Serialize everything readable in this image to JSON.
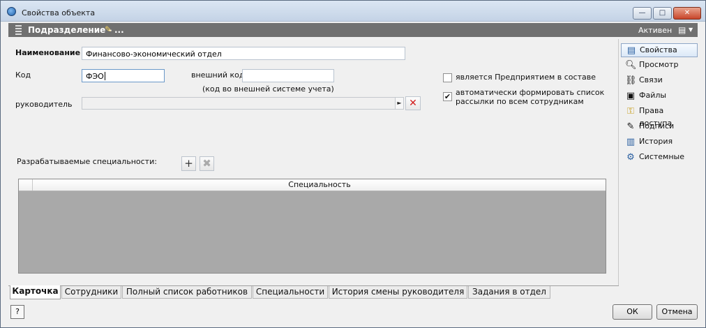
{
  "window": {
    "title": "Свойства объекта",
    "controls": {
      "minimize": "—",
      "maximize": "□",
      "close": "✕"
    }
  },
  "object_bar": {
    "title": "Подразделение -",
    "edit_suffix": "...",
    "status": "Активен",
    "menu_icon": "▤",
    "menu_arrow": "▼"
  },
  "form": {
    "name_label": "Наименование",
    "name_value": "Финансово-экономический отдел",
    "code_label": "Код",
    "code_value": "ФЭО",
    "ext_code_label": "внешний код",
    "ext_code_value": "",
    "ext_code_hint": "(код во внешней системе учета)",
    "manager_label": "руководитель",
    "manager_value": "",
    "checkbox_enterprise_label": "является Предприятием в составе",
    "checkbox_enterprise_checked": false,
    "checkbox_mailing_label_line1": "автоматически формировать список",
    "checkbox_mailing_label_line2": "рассылки по всем сотрудникам",
    "checkbox_mailing_checked": true,
    "specialties_label": "Разрабатываемые специальности:",
    "add_symbol": "+",
    "remove_symbol": "✖"
  },
  "grid": {
    "columns": [
      "Специальность"
    ],
    "rows": []
  },
  "tabs": [
    {
      "label": "Карточка",
      "active": true
    },
    {
      "label": "Сотрудники",
      "active": false
    },
    {
      "label": "Полный список работников",
      "active": false
    },
    {
      "label": "Специальности",
      "active": false
    },
    {
      "label": "История смены руководителя",
      "active": false
    },
    {
      "label": "Задания в отдел",
      "active": false
    }
  ],
  "side_nav": [
    {
      "label": "Свойства",
      "icon": "properties-icon",
      "active": true
    },
    {
      "label": "Просмотр",
      "icon": "magnifier-icon",
      "active": false
    },
    {
      "label": "Связи",
      "icon": "link-icon",
      "active": false
    },
    {
      "label": "Файлы",
      "icon": "files-icon",
      "active": false
    },
    {
      "label": "Права доступа",
      "icon": "key-icon",
      "active": false
    },
    {
      "label": "Подписи",
      "icon": "signature-icon",
      "active": false
    },
    {
      "label": "История",
      "icon": "history-icon",
      "active": false
    },
    {
      "label": "Системные",
      "icon": "system-icon",
      "active": false
    }
  ],
  "footer": {
    "help_label": "?",
    "ok_label": "ОК",
    "cancel_label": "Отмена"
  }
}
